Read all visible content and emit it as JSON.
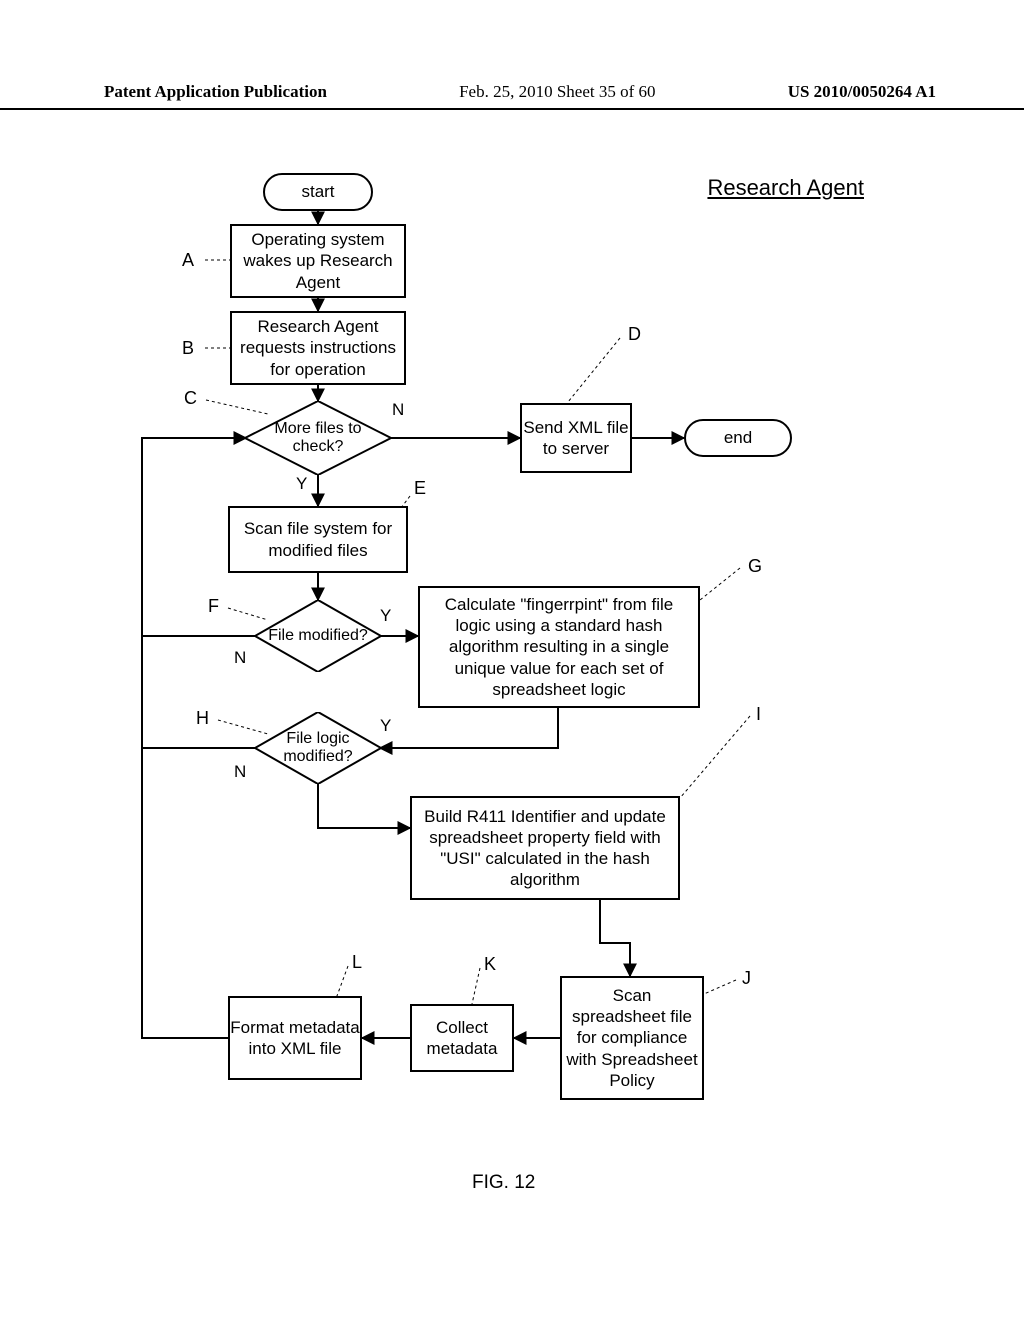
{
  "header": {
    "left": "Patent Application Publication",
    "center": "Feb. 25, 2010  Sheet 35 of 60",
    "right": "US 2010/0050264 A1"
  },
  "title": "Research Agent",
  "figure_label": "FIG. 12",
  "nodes": {
    "start": "start",
    "end": "end",
    "A": "Operating system wakes up Research Agent",
    "B": "Research Agent requests instructions for operation",
    "C": "More files to check?",
    "D": "Send XML file to server",
    "E": "Scan file system for modified files",
    "F": "File modified?",
    "G": "Calculate \"fingerrpint\" from file logic using a standard hash algorithm resulting in a single unique value for each set of spreadsheet logic",
    "H": "File logic modified?",
    "I": "Build R411 Identifier and update spreadsheet property field with \"USI\" calculated in the hash algorithm",
    "J": "Scan spreadsheet file for compliance with Spreadsheet Policy",
    "K": "Collect metadata",
    "L": "Format metadata into XML file"
  },
  "labels": {
    "A": "A",
    "B": "B",
    "C": "C",
    "D": "D",
    "E": "E",
    "F": "F",
    "G": "G",
    "H": "H",
    "I": "I",
    "J": "J",
    "K": "K",
    "L": "L",
    "Y": "Y",
    "N": "N"
  },
  "chart_data": {
    "type": "flowchart",
    "title": "Research Agent",
    "nodes": [
      {
        "id": "start",
        "type": "terminator",
        "label": "start"
      },
      {
        "id": "A",
        "type": "process",
        "label": "Operating system wakes up Research Agent"
      },
      {
        "id": "B",
        "type": "process",
        "label": "Research Agent requests instructions for operation"
      },
      {
        "id": "C",
        "type": "decision",
        "label": "More files to check?"
      },
      {
        "id": "D",
        "type": "process",
        "label": "Send XML file to server"
      },
      {
        "id": "end",
        "type": "terminator",
        "label": "end"
      },
      {
        "id": "E",
        "type": "process",
        "label": "Scan file system for modified files"
      },
      {
        "id": "F",
        "type": "decision",
        "label": "File modified?"
      },
      {
        "id": "G",
        "type": "process",
        "label": "Calculate \"fingerrpint\" from file logic using a standard hash algorithm resulting in a single unique value for each set of spreadsheet logic"
      },
      {
        "id": "H",
        "type": "decision",
        "label": "File logic modified?"
      },
      {
        "id": "I",
        "type": "process",
        "label": "Build R411 Identifier and update spreadsheet property field with \"USI\" calculated in the hash algorithm"
      },
      {
        "id": "J",
        "type": "process",
        "label": "Scan spreadsheet file for compliance with Spreadsheet Policy"
      },
      {
        "id": "K",
        "type": "process",
        "label": "Collect metadata"
      },
      {
        "id": "L",
        "type": "process",
        "label": "Format metadata into XML file"
      }
    ],
    "edges": [
      {
        "from": "start",
        "to": "A"
      },
      {
        "from": "A",
        "to": "B"
      },
      {
        "from": "B",
        "to": "C"
      },
      {
        "from": "C",
        "to": "D",
        "label": "N"
      },
      {
        "from": "C",
        "to": "E",
        "label": "Y"
      },
      {
        "from": "D",
        "to": "end"
      },
      {
        "from": "E",
        "to": "F"
      },
      {
        "from": "F",
        "to": "G",
        "label": "Y"
      },
      {
        "from": "F",
        "to": "L_loop",
        "label": "N",
        "note": "back to C via left side"
      },
      {
        "from": "G",
        "to": "H"
      },
      {
        "from": "H",
        "to": "I",
        "label": "Y",
        "note": "via right then down"
      },
      {
        "from": "H",
        "to": "I",
        "label": "N",
        "note": "down then right"
      },
      {
        "from": "I",
        "to": "J"
      },
      {
        "from": "J",
        "to": "K"
      },
      {
        "from": "K",
        "to": "L"
      },
      {
        "from": "L",
        "to": "C",
        "note": "loop back via left side"
      }
    ]
  }
}
